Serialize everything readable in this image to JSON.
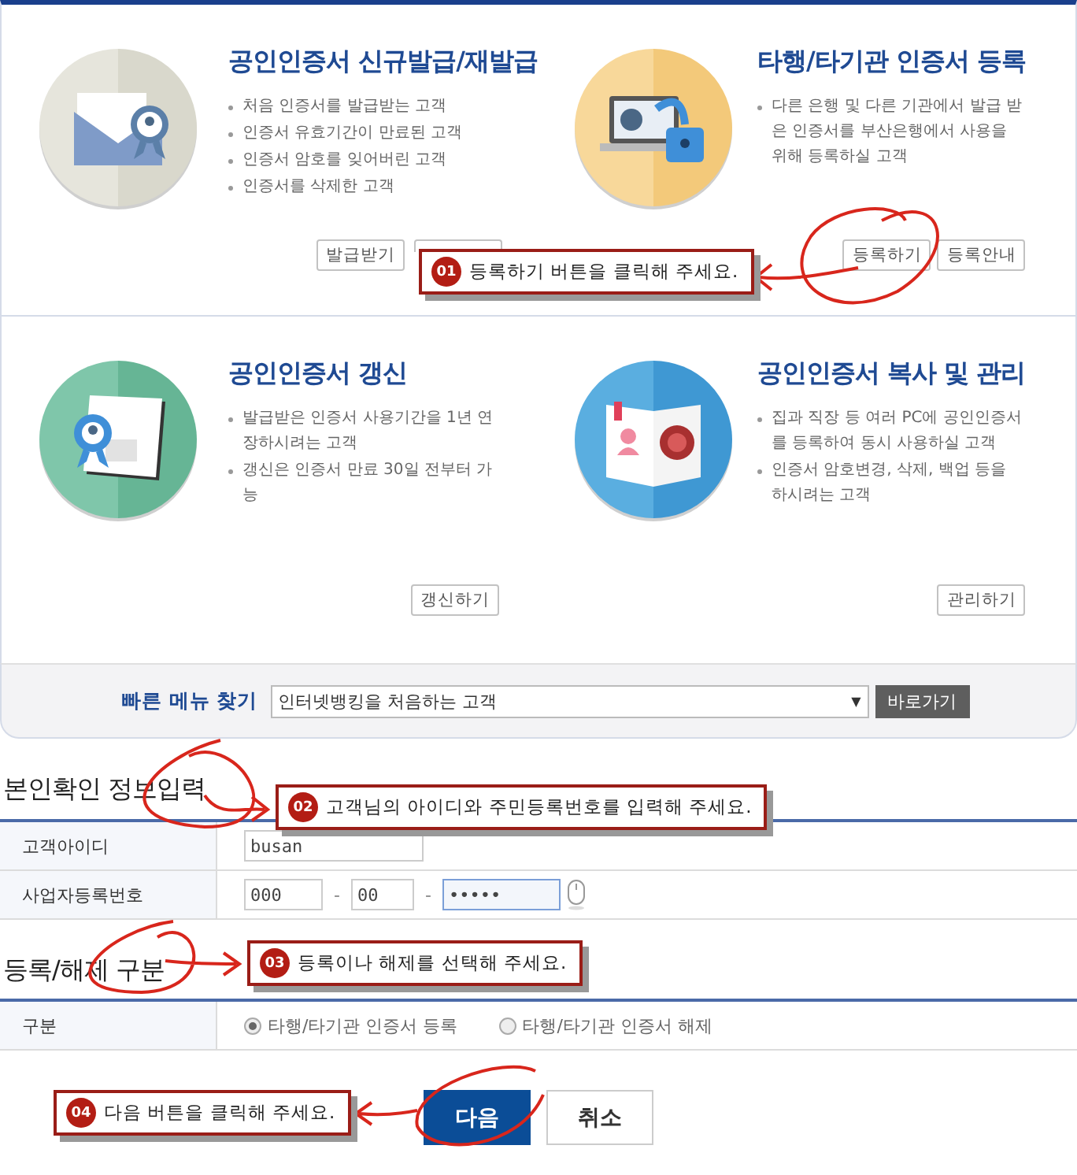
{
  "services": [
    {
      "kind": "envelope",
      "title": "공인인증서 신규발급/재발급",
      "bullets": [
        "처음 인증서를 발급받는 고객",
        "인증서 유효기간이 만료된 고객",
        "인증서 암호를 잊어버린 고객",
        "인증서를 삭제한 고객"
      ],
      "buttons": [
        {
          "kind": "button",
          "label": "발급받기"
        },
        {
          "kind": "covered"
        }
      ]
    },
    {
      "kind": "laptop",
      "title": "타행/타기관 인증서 등록",
      "bullets": [
        "다른 은행 및 다른 기관에서 발급 받은 인증서를 부산은행에서 사용을 위해 등록하실 고객"
      ],
      "buttons": [
        {
          "kind": "button",
          "label": "등록하기"
        },
        {
          "kind": "button",
          "label": "등록안내"
        }
      ]
    },
    {
      "kind": "calendar",
      "title": "공인인증서 갱신",
      "bullets": [
        "발급받은 인증서 사용기간을 1년 연장하시려는 고객",
        "갱신은 인증서 만료 30일 전부터 가능"
      ],
      "buttons": [
        {
          "kind": "button",
          "label": "갱신하기"
        }
      ]
    },
    {
      "kind": "book",
      "title": "공인인증서 복사 및 관리",
      "bullets": [
        "집과 직장 등 여러 PC에 공인인증서를 등록하여 동시 사용하실 고객",
        "인증서 암호변경, 삭제, 백업 등을 하시려는 고객"
      ],
      "buttons": [
        {
          "kind": "button",
          "label": "관리하기"
        }
      ]
    }
  ],
  "quick_menu": {
    "label": "빠른 메뉴 찾기",
    "value": "인터넷뱅킹을 처음하는 고객",
    "arrow": "▼",
    "button": "바로가기"
  },
  "identity_section": {
    "heading": "본인확인 정보입력",
    "rows": [
      {
        "kind": "text",
        "label": "고객아이디",
        "value": "busan"
      },
      {
        "kind": "split",
        "label": "사업자등록번호",
        "separator": "-",
        "fields": [
          {
            "value": "000",
            "focused": false
          },
          {
            "value": "00",
            "focused": false
          },
          {
            "value": "•••••",
            "focused": true
          }
        ]
      }
    ]
  },
  "type_section": {
    "heading": "등록/해제 구분",
    "label": "구분",
    "options": [
      {
        "label": "타행/타기관 인증서 등록",
        "selected": true
      },
      {
        "label": "타행/타기관 인증서 해제",
        "selected": false
      }
    ]
  },
  "actions": [
    {
      "kind": "primary",
      "label": "다음"
    },
    {
      "kind": "secondary",
      "label": "취소"
    }
  ],
  "callouts": [
    {
      "number": "01",
      "text": "등록하기 버튼을 클릭해 주세요."
    },
    {
      "number": "02",
      "text": "고객님의 아이디와 주민등록번호를 입력해 주세요."
    },
    {
      "number": "03",
      "text": "등록이나 해제를 선택해 주세요."
    },
    {
      "number": "04",
      "text": "다음 버튼을 클릭해 주세요."
    }
  ]
}
